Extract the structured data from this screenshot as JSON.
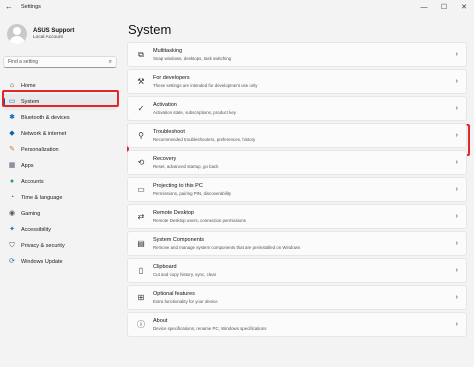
{
  "window": {
    "title": "Settings",
    "back": "←",
    "min": "—",
    "max": "☐",
    "close": "✕"
  },
  "profile": {
    "name": "ASUS Support",
    "sub": "Local Account"
  },
  "search": {
    "placeholder": "Find a setting",
    "icon": "⌕"
  },
  "sidebar": {
    "items": [
      {
        "label": "Home",
        "icon": "home-icon",
        "glyph": "⌂",
        "color": "#333333"
      },
      {
        "label": "System",
        "icon": "monitor-icon",
        "glyph": "▭",
        "color": "#0067c0",
        "active": true
      },
      {
        "label": "Bluetooth & devices",
        "icon": "bluetooth-icon",
        "glyph": "✱",
        "color": "#0067c0"
      },
      {
        "label": "Network & internet",
        "icon": "wifi-icon",
        "glyph": "◆",
        "color": "#0a64b5"
      },
      {
        "label": "Personalization",
        "icon": "brush-icon",
        "glyph": "✎",
        "color": "#c77818"
      },
      {
        "label": "Apps",
        "icon": "apps-icon",
        "glyph": "▦",
        "color": "#505a6e"
      },
      {
        "label": "Accounts",
        "icon": "person-icon",
        "glyph": "●",
        "color": "#23a356"
      },
      {
        "label": "Time & language",
        "icon": "globe-clock-icon",
        "glyph": "◔",
        "color": "#1d6fc1"
      },
      {
        "label": "Gaming",
        "icon": "gamepad-icon",
        "glyph": "◉",
        "color": "#555555"
      },
      {
        "label": "Accessibility",
        "icon": "accessibility-icon",
        "glyph": "✦",
        "color": "#1e6dc7"
      },
      {
        "label": "Privacy & security",
        "icon": "shield-icon",
        "glyph": "⛉",
        "color": "#555555"
      },
      {
        "label": "Windows Update",
        "icon": "update-icon",
        "glyph": "⟳",
        "color": "#1d6fc1"
      }
    ]
  },
  "main": {
    "title": "System",
    "cards": [
      {
        "title": "Multitasking",
        "desc": "Snap windows, desktops, task switching",
        "icon": "multitasking-icon",
        "glyph": "⧉"
      },
      {
        "title": "For developers",
        "desc": "These settings are intended for development use only",
        "icon": "developer-icon",
        "glyph": "⚒"
      },
      {
        "title": "Activation",
        "desc": "Activation state, subscriptions, product key",
        "icon": "activation-icon",
        "glyph": "✓"
      },
      {
        "title": "Troubleshoot",
        "desc": "Recommended troubleshooters, preferences, history",
        "icon": "wrench-icon",
        "glyph": "⚲"
      },
      {
        "title": "Recovery",
        "desc": "Reset, advanced startup, go back",
        "icon": "recovery-icon",
        "glyph": "⟲"
      },
      {
        "title": "Projecting to this PC",
        "desc": "Permissions, pairing PIN, discoverability",
        "icon": "projecting-icon",
        "glyph": "▭"
      },
      {
        "title": "Remote Desktop",
        "desc": "Remote Desktop users, connection permissions",
        "icon": "remote-desktop-icon",
        "glyph": "⇄"
      },
      {
        "title": "System Components",
        "desc": "Remove and manage system components that are preinstalled on Windows",
        "icon": "components-icon",
        "glyph": "▤"
      },
      {
        "title": "Clipboard",
        "desc": "Cut and copy history, sync, clear",
        "icon": "clipboard-icon",
        "glyph": "▯"
      },
      {
        "title": "Optional features",
        "desc": "Extra functionality for your device",
        "icon": "optional-features-icon",
        "glyph": "⊞"
      },
      {
        "title": "About",
        "desc": "Device specifications, rename PC, Windows specifications",
        "icon": "info-icon",
        "glyph": "ⓘ"
      }
    ],
    "chevron": "›"
  }
}
